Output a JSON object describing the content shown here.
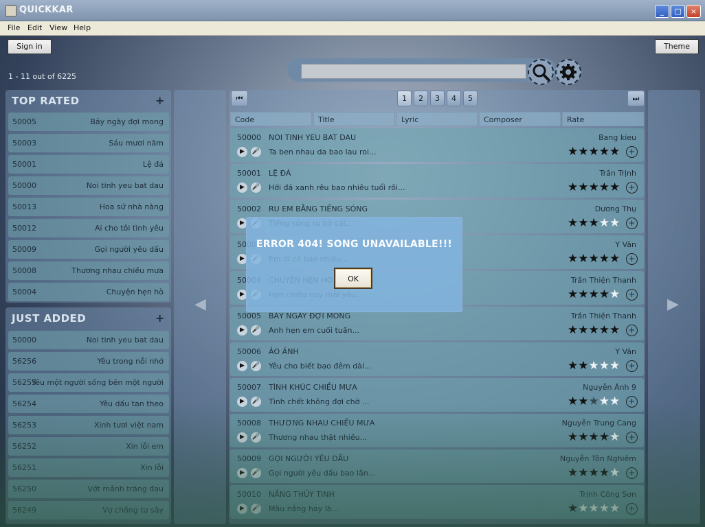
{
  "window": {
    "title": "QUICKKAR",
    "minimize": "_",
    "maximize": "□",
    "close": "×"
  },
  "menu": [
    "File",
    "Edit",
    "View",
    "Help"
  ],
  "toolbar": {
    "sign_in": "Sign in",
    "theme": "Theme",
    "count": "1 - 11 out of 6225",
    "search_value": ""
  },
  "top_rated": {
    "heading": "TOP RATED",
    "items": [
      {
        "code": "50005",
        "name": "Bảy ngày đợi mong"
      },
      {
        "code": "50003",
        "name": "Sáu mươi năm"
      },
      {
        "code": "50001",
        "name": "Lệ đá"
      },
      {
        "code": "50000",
        "name": "Noi tinh yeu bat dau"
      },
      {
        "code": "50013",
        "name": "Hoa sứ nhà nàng"
      },
      {
        "code": "50012",
        "name": "Ai cho tôi tình yêu"
      },
      {
        "code": "50009",
        "name": "Gọi người yêu dấu"
      },
      {
        "code": "50008",
        "name": "Thương nhau chiều mưa"
      },
      {
        "code": "50004",
        "name": "Chuyện hẹn hò"
      }
    ]
  },
  "just_added": {
    "heading": "JUST ADDED",
    "items": [
      {
        "code": "50000",
        "name": "Noi tinh yeu bat dau"
      },
      {
        "code": "56256",
        "name": "Yêu trong nỗi nhớ"
      },
      {
        "code": "56255",
        "name": "Yêu một người sống bên một người"
      },
      {
        "code": "56254",
        "name": "Yêu dấu tan theo"
      },
      {
        "code": "56253",
        "name": "Xinh tươi việt nam"
      },
      {
        "code": "56252",
        "name": "Xin lỗi em"
      },
      {
        "code": "56251",
        "name": "Xin lỗi"
      },
      {
        "code": "56250",
        "name": "Vớt mảnh trăng đau"
      },
      {
        "code": "56249",
        "name": "Vợ chồng tư sây"
      }
    ]
  },
  "pagination": {
    "first": "⏮",
    "last": "⏭",
    "pages": [
      "1",
      "2",
      "3",
      "4",
      "5"
    ],
    "active": "1"
  },
  "columns": [
    "Code",
    "Title",
    "Lyric",
    "Composer",
    "Rate"
  ],
  "songs": [
    {
      "code": "50000",
      "title": "NOI TINH YEU BAT DAU",
      "composer": "Bang kieu",
      "lyric": "Ta ben nhau da bao lau roi...",
      "rating": 5
    },
    {
      "code": "50001",
      "title": "LỆ ĐÁ",
      "composer": "Trần Trịnh",
      "lyric": "Hỡi đá xanh rêu bao nhiêu tuổi rồi...",
      "rating": 5
    },
    {
      "code": "50002",
      "title": "RU EM BẰNG TIẾNG SÓNG",
      "composer": "Dương Thụ",
      "lyric": "Tiếng sóng ru bờ cát...",
      "rating": 3
    },
    {
      "code": "50003",
      "title": "",
      "composer": "Y Vân",
      "lyric": "Em ơi có bao nhiêu...",
      "rating": 5
    },
    {
      "code": "50004",
      "title": "CHUYỆN HẸN HÒ",
      "composer": "Trần Thiện Thanh",
      "lyric": "Hẹn chiều nay mãi yêu...",
      "rating": 4
    },
    {
      "code": "50005",
      "title": "BẢY NGÀY ĐỢI MONG",
      "composer": "Trần Thiện Thanh",
      "lyric": "Anh hẹn em cuối tuần...",
      "rating": 5
    },
    {
      "code": "50006",
      "title": "ẢO ẢNH",
      "composer": "Y Vân",
      "lyric": "Yêu cho biết bao đêm dài...",
      "rating": 2
    },
    {
      "code": "50007",
      "title": "TÌNH KHÚC CHIỀU MƯA",
      "composer": "Nguyễn Ánh 9",
      "lyric": "Tình chết không đợi chờ ...",
      "rating": 2.5
    },
    {
      "code": "50008",
      "title": "THƯƠNG NHAU CHIỀU MƯA",
      "composer": "Nguyễn Trung Cang",
      "lyric": "Thương nhau thật nhiều...",
      "rating": 4
    },
    {
      "code": "50009",
      "title": "GỌI NGƯỜI YÊU DẤU",
      "composer": "Nguyễn Tôn Nghiêm",
      "lyric": "Gọi người yêu dấu bao lần...",
      "rating": 4
    },
    {
      "code": "50010",
      "title": "NẮNG THỦY TINH",
      "composer": "Trịnh Công Sơn",
      "lyric": "Màu nắng hay là...",
      "rating": 1
    }
  ],
  "icons": {
    "play": "▶",
    "mic": "🎤",
    "add": "+",
    "prev": "◀",
    "next": "▶"
  },
  "dialog": {
    "message": "ERROR 404! SONG UNAVAILABLE!!!",
    "ok": "OK"
  }
}
